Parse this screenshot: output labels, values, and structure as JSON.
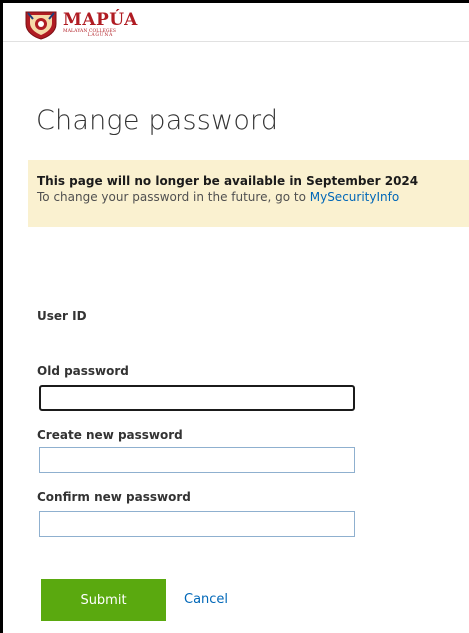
{
  "logo": {
    "name": "MAPÚA",
    "sub": "MALAYAN COLLEGES",
    "sub2": "LAGUNA"
  },
  "page": {
    "title": "Change password"
  },
  "notice": {
    "title": "This page will no longer be available in September 2024",
    "body": "To change your password in the future, go to ",
    "link": "MySecurityInfo"
  },
  "form": {
    "user_id_label": "User ID",
    "old_password_label": "Old password",
    "old_password_value": "",
    "new_password_label": "Create new password",
    "new_password_value": "",
    "confirm_password_label": "Confirm new password",
    "confirm_password_value": ""
  },
  "actions": {
    "submit_label": "Submit",
    "cancel_label": "Cancel"
  },
  "colors": {
    "brand": "#b01c23",
    "submit": "#5aa90f",
    "link": "#0067b8",
    "notice_bg": "#faf1d0"
  }
}
